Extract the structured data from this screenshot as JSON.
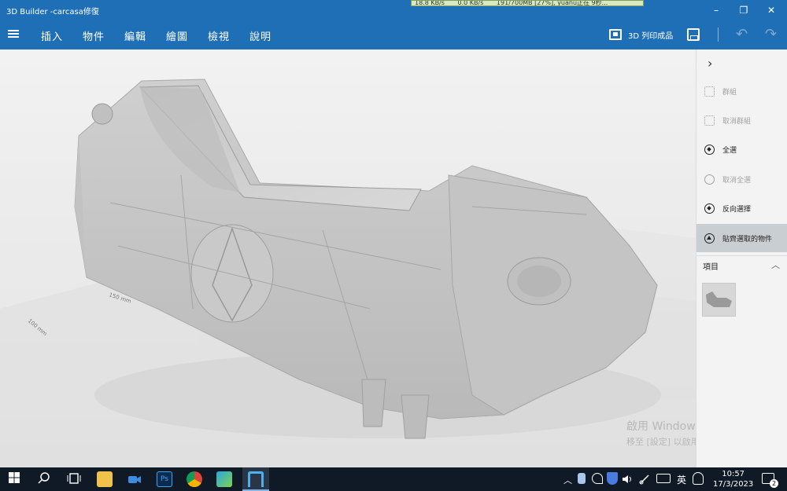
{
  "window": {
    "title": "3D Builder -carcasa修復",
    "controls": {
      "minimize": "–",
      "maximize": "❐",
      "close": "✕"
    }
  },
  "net_widget": {
    "items": [
      "18.8 KB/s",
      "0.0 KB/s",
      "191/700MB [27%], yuanu正在 9秒..."
    ]
  },
  "menu": {
    "items": [
      "插入",
      "物件",
      "編輯",
      "繪圖",
      "檢視",
      "說明"
    ],
    "print_label": "3D 列印成品",
    "undo": "↶",
    "redo": "↷"
  },
  "viewport": {
    "ruler_labels": [
      "150 mm",
      "100 mm"
    ],
    "watermark": {
      "line1": "啟用 Windows",
      "line2": "移至 [設定] 以啟用 Windows。"
    }
  },
  "panel": {
    "collapse": "›",
    "actions": [
      {
        "label": "群組",
        "state": "disabled"
      },
      {
        "label": "取消群組",
        "state": "disabled"
      },
      {
        "label": "全選",
        "state": "enabled"
      },
      {
        "label": "取消全選",
        "state": "disabled"
      },
      {
        "label": "反向選擇",
        "state": "enabled"
      },
      {
        "label": "貼齊選取的物件",
        "state": "active"
      }
    ],
    "items_header": "項目",
    "items_toggle": "︿"
  },
  "taskbar": {
    "tray": {
      "chevron": "︿",
      "ime": "英"
    },
    "clock": {
      "time": "10:57",
      "date": "17/3/2023"
    },
    "notifications": "2"
  },
  "colors": {
    "accent": "#1e6fb5",
    "taskbar": "#101a27",
    "panel": "#f3f3f3"
  }
}
